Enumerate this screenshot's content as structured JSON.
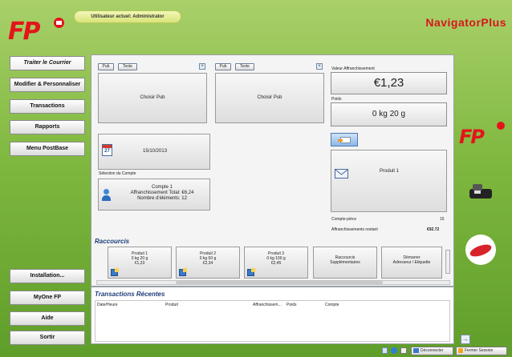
{
  "header": {
    "current_user": "Utilisateur actuel: Administrator",
    "brand": "NavigatorPlus",
    "logo_text": "FP"
  },
  "nav": [
    {
      "label": "Traiter le Courrier",
      "active": true
    },
    {
      "label": "Modifier & Personnaliser",
      "active": false
    },
    {
      "label": "Transactions",
      "active": false
    },
    {
      "label": "Rapports",
      "active": false
    },
    {
      "label": "Menu PostBase",
      "active": false
    },
    {
      "label": "Installation...",
      "active": false
    },
    {
      "label": "MyOne FP",
      "active": false
    },
    {
      "label": "Aide",
      "active": false
    },
    {
      "label": "Sortir",
      "active": false
    }
  ],
  "ads": [
    {
      "pub_label": "Pub",
      "text_label": "Texte",
      "choose_label": "Choisir Pub"
    },
    {
      "pub_label": "Pub",
      "text_label": "Texte",
      "choose_label": "Choisir Pub"
    }
  ],
  "date": "15/10/2013",
  "date_icon_day": "27",
  "account": {
    "section_label": "Sélection du Compte",
    "name": "Compte 1",
    "total": "Affranchissement Total: €6,24",
    "count": "Nombre d'éléments: 12"
  },
  "postage": {
    "value_label": "Valeur Affranchissement",
    "value": "€1,23",
    "weight_label": "Poids",
    "weight": "0 kg 20 g"
  },
  "product": {
    "label": "Produit 1"
  },
  "counters": {
    "counter_label": "Compte-pièce",
    "counter_value": "15",
    "remaining_label": "Affranchissements restant",
    "remaining_value": "€92.72"
  },
  "shortcuts": {
    "title": "Raccourcis",
    "items": [
      {
        "line1": "Produit 1",
        "line2": "0 kg 20 g",
        "line3": "€1,23"
      },
      {
        "line1": "Produit 2",
        "line2": "0 kg 50 g",
        "line3": "€2,34"
      },
      {
        "line1": "Produit 3",
        "line2": "0 kg 100 g",
        "line3": "€2,45"
      },
      {
        "line1": "Raccourcis",
        "line2": "Supplémentaires",
        "line3": ""
      },
      {
        "line1": "Démarrer",
        "line2": "Adresseur / Etiquette",
        "line3": ""
      }
    ]
  },
  "recent": {
    "title": "Transactions Récentes",
    "columns": [
      "Date/Heure",
      "Produit",
      "Affranchissem...",
      "Poids",
      "Compte"
    ]
  },
  "status_bar": {
    "disconnect": "Déconnecter",
    "close_session": "Fermer Session"
  },
  "colors": {
    "brand_red": "#e3151a",
    "background_green": "#7fb83f",
    "section_blue": "#1d3c7a"
  }
}
